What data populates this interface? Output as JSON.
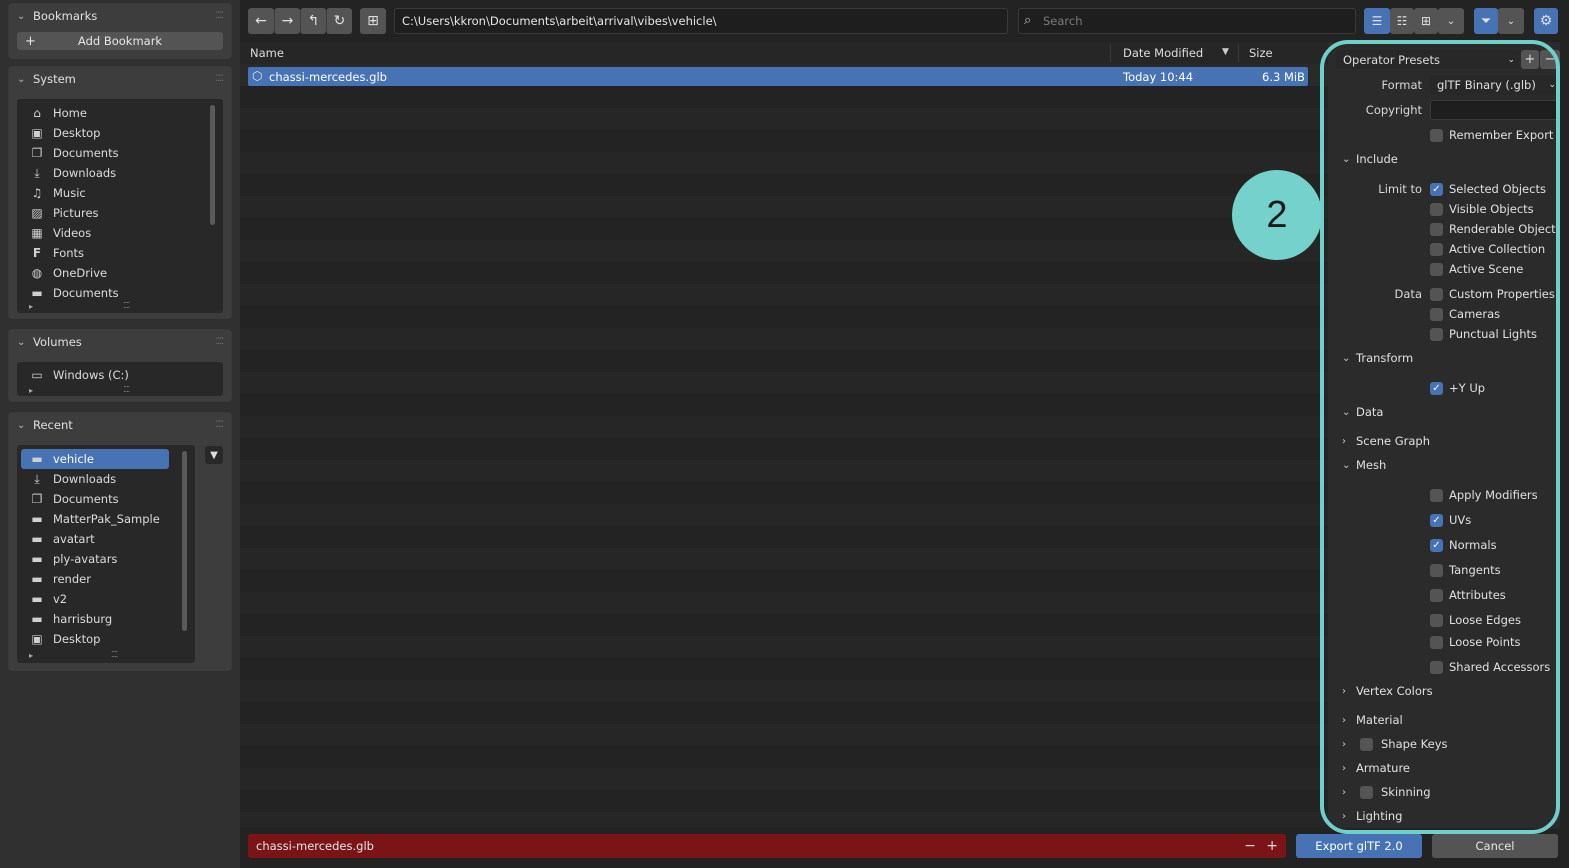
{
  "sidebar": {
    "bookmarks": {
      "title": "Bookmarks",
      "add_label": "Add Bookmark"
    },
    "system": {
      "title": "System",
      "items": [
        {
          "label": "Home",
          "icon": "home-icon"
        },
        {
          "label": "Desktop",
          "icon": "desktop-icon"
        },
        {
          "label": "Documents",
          "icon": "documents-icon"
        },
        {
          "label": "Downloads",
          "icon": "download-icon"
        },
        {
          "label": "Music",
          "icon": "music-icon"
        },
        {
          "label": "Pictures",
          "icon": "pictures-icon"
        },
        {
          "label": "Videos",
          "icon": "videos-icon"
        },
        {
          "label": "Fonts",
          "icon": "fonts-icon"
        },
        {
          "label": "OneDrive",
          "icon": "globe-icon"
        },
        {
          "label": "Documents",
          "icon": "folder-icon"
        }
      ]
    },
    "volumes": {
      "title": "Volumes",
      "items": [
        {
          "label": "Windows (C:)",
          "icon": "drive-icon"
        }
      ]
    },
    "recent": {
      "title": "Recent",
      "items": [
        {
          "label": "vehicle",
          "icon": "folder-icon",
          "selected": true
        },
        {
          "label": "Downloads",
          "icon": "download-icon"
        },
        {
          "label": "Documents",
          "icon": "documents-icon"
        },
        {
          "label": "MatterPak_Sample",
          "icon": "folder-icon"
        },
        {
          "label": "avatart",
          "icon": "folder-icon"
        },
        {
          "label": "ply-avatars",
          "icon": "folder-icon"
        },
        {
          "label": "render",
          "icon": "folder-icon"
        },
        {
          "label": "v2",
          "icon": "folder-icon"
        },
        {
          "label": "harrisburg",
          "icon": "folder-icon"
        },
        {
          "label": "Desktop",
          "icon": "desktop-icon"
        }
      ]
    }
  },
  "toolbar": {
    "path": "C:\\Users\\kkron\\Documents\\arbeit\\arrival\\vibes\\vehicle\\",
    "search_placeholder": "Search"
  },
  "filelist": {
    "columns": {
      "name": "Name",
      "date": "Date Modified",
      "size": "Size"
    },
    "rows": [
      {
        "name": "chassi-mercedes.glb",
        "date": "Today 10:44",
        "size": "6.3 MiB",
        "selected": true
      }
    ]
  },
  "bottom": {
    "filename": "chassi-mercedes.glb",
    "export_label": "Export glTF 2.0",
    "cancel_label": "Cancel"
  },
  "settings": {
    "presets": "Operator Presets",
    "format_label": "Format",
    "format_value": "glTF Binary (.glb)",
    "copyright_label": "Copyright",
    "copyright_value": "",
    "remember_label": "Remember Export ...",
    "include": {
      "title": "Include",
      "limit_to_label": "Limit to",
      "limit_to": [
        {
          "label": "Selected Objects",
          "checked": true
        },
        {
          "label": "Visible Objects",
          "checked": false
        },
        {
          "label": "Renderable Objects",
          "checked": false
        },
        {
          "label": "Active Collection",
          "checked": false
        },
        {
          "label": "Active Scene",
          "checked": false
        }
      ],
      "data_label": "Data",
      "data": [
        {
          "label": "Custom Properties",
          "checked": false
        },
        {
          "label": "Cameras",
          "checked": false
        },
        {
          "label": "Punctual Lights",
          "checked": false
        }
      ]
    },
    "transform": {
      "title": "Transform",
      "y_up_label": "+Y Up",
      "y_up": true
    },
    "data": {
      "title": "Data",
      "scene_graph": "Scene Graph",
      "mesh": {
        "title": "Mesh",
        "options": [
          {
            "label": "Apply Modifiers",
            "checked": false
          },
          {
            "label": "UVs",
            "checked": true
          },
          {
            "label": "Normals",
            "checked": true
          },
          {
            "label": "Tangents",
            "checked": false
          },
          {
            "label": "Attributes",
            "checked": false
          },
          {
            "label": "Loose Edges",
            "checked": false
          },
          {
            "label": "Loose Points",
            "checked": false
          },
          {
            "label": "Shared Accessors",
            "checked": false
          }
        ]
      },
      "vertex_colors": "Vertex Colors",
      "material": "Material",
      "shape_keys": "Shape Keys",
      "armature": "Armature",
      "skinning": "Skinning",
      "lighting": "Lighting"
    }
  },
  "annotation": {
    "badge": "2",
    "color": "#6fcfc9"
  },
  "colors": {
    "accent": "#4772b3",
    "danger_field": "#7a1416"
  }
}
